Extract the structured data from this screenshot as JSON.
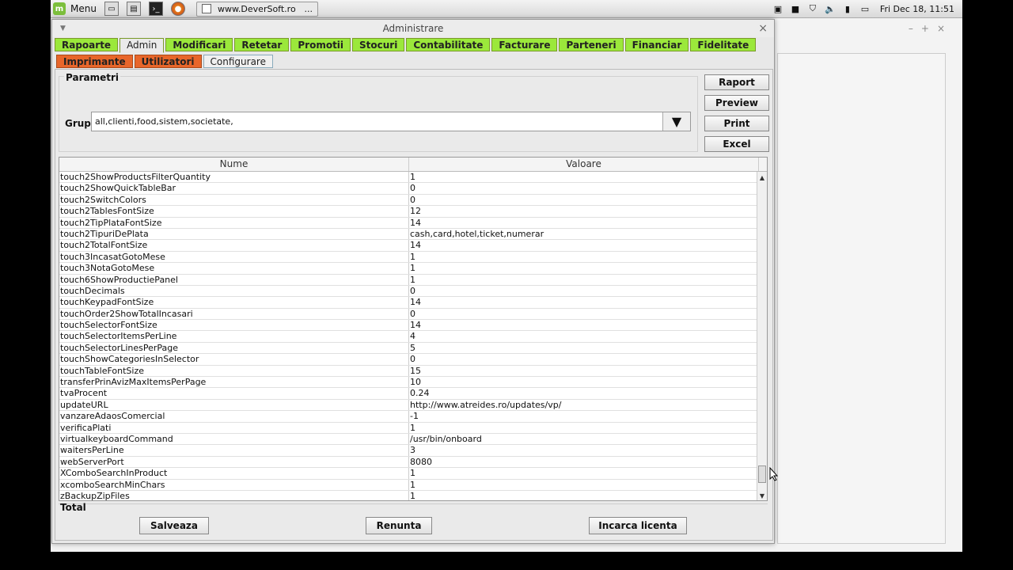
{
  "taskbar": {
    "menu_label": "Menu",
    "task_title": "www.DeverSoft.ro",
    "task_dots": "...",
    "clock": "Fri Dec 18, 11:51"
  },
  "window": {
    "title": "Administrare",
    "close": "×"
  },
  "tabs": [
    {
      "label": "Rapoarte"
    },
    {
      "label": "Admin"
    },
    {
      "label": "Modificari"
    },
    {
      "label": "Retetar"
    },
    {
      "label": "Promotii"
    },
    {
      "label": "Stocuri"
    },
    {
      "label": "Contabilitate"
    },
    {
      "label": "Facturare"
    },
    {
      "label": "Parteneri"
    },
    {
      "label": "Financiar"
    },
    {
      "label": "Fidelitate"
    }
  ],
  "subtabs": [
    {
      "label": "Imprimante"
    },
    {
      "label": "Utilizatori"
    },
    {
      "label": "Configurare"
    }
  ],
  "params": {
    "legend": "Parametri",
    "grup_label": "Grup",
    "grup_value": "all,clienti,food,sistem,societate,"
  },
  "side_buttons": {
    "raport": "Raport",
    "preview": "Preview",
    "print": "Print",
    "excel": "Excel"
  },
  "table": {
    "col1": "Nume",
    "col2": "Valoare",
    "rows": [
      [
        "touch2ShowProductsFilterQuantity",
        "1"
      ],
      [
        "touch2ShowQuickTableBar",
        "0"
      ],
      [
        "touch2SwitchColors",
        "0"
      ],
      [
        "touch2TablesFontSize",
        "12"
      ],
      [
        "touch2TipPlataFontSize",
        "14"
      ],
      [
        "touch2TipuriDePlata",
        "cash,card,hotel,ticket,numerar"
      ],
      [
        "touch2TotalFontSize",
        "14"
      ],
      [
        "touch3IncasatGotoMese",
        "1"
      ],
      [
        "touch3NotaGotoMese",
        "1"
      ],
      [
        "touch6ShowProductiePanel",
        "1"
      ],
      [
        "touchDecimals",
        "0"
      ],
      [
        "touchKeypadFontSize",
        "14"
      ],
      [
        "touchOrder2ShowTotalIncasari",
        "0"
      ],
      [
        "touchSelectorFontSize",
        "14"
      ],
      [
        "touchSelectorItemsPerLine",
        "4"
      ],
      [
        "touchSelectorLinesPerPage",
        "5"
      ],
      [
        "touchShowCategoriesInSelector",
        "0"
      ],
      [
        "touchTableFontSize",
        "15"
      ],
      [
        "transferPrinAvizMaxItemsPerPage",
        "10"
      ],
      [
        "tvaProcent",
        "0.24"
      ],
      [
        "updateURL",
        "http://www.atreides.ro/updates/vp/"
      ],
      [
        "vanzareAdaosComercial",
        "-1"
      ],
      [
        "verificaPlati",
        "1"
      ],
      [
        "virtualkeyboardCommand",
        "/usr/bin/onboard"
      ],
      [
        "waitersPerLine",
        "3"
      ],
      [
        "webServerPort",
        "8080"
      ],
      [
        "XComboSearchInProduct",
        "1"
      ],
      [
        "xcomboSearchMinChars",
        "1"
      ],
      [
        "zBackupZipFiles",
        "1"
      ]
    ]
  },
  "total": {
    "legend": "Total",
    "save": "Salveaza",
    "cancel": "Renunta",
    "license": "Incarca licenta"
  },
  "colors": {
    "tab_green": "#9be83b",
    "subtab_orange": "#e8662a"
  }
}
